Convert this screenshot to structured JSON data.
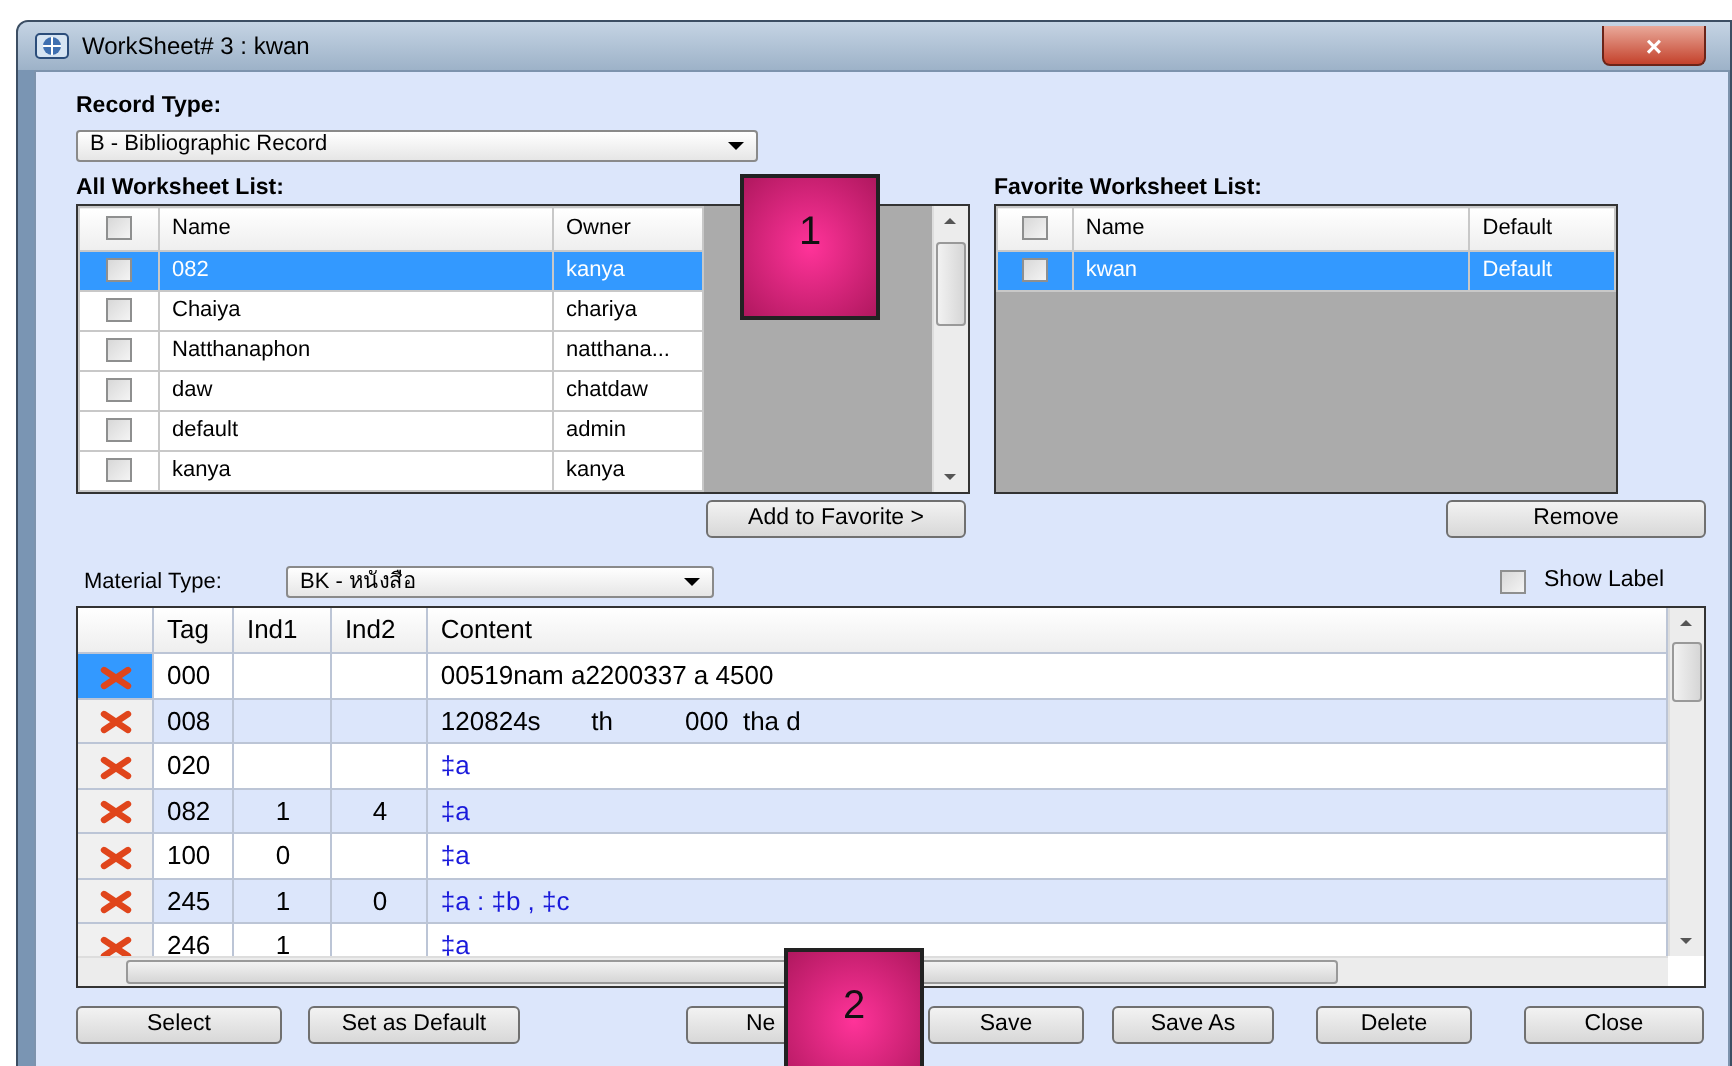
{
  "window": {
    "title": "WorkSheet# 3 : kwan",
    "close": "×"
  },
  "record_type": {
    "label": "Record Type:",
    "value": "B - Bibliographic Record"
  },
  "all_worksheets": {
    "label": "All Worksheet List:",
    "all_checked": false,
    "columns": [
      "Name",
      "Owner"
    ],
    "rows": [
      {
        "name": "082",
        "owner": "kanya",
        "checked": false,
        "selected": true
      },
      {
        "name": "Chaiya",
        "owner": "chariya",
        "checked": false,
        "selected": false
      },
      {
        "name": "Natthanaphon",
        "owner": "natthana...",
        "checked": false,
        "selected": false
      },
      {
        "name": "daw",
        "owner": "chatdaw",
        "checked": false,
        "selected": false
      },
      {
        "name": "default",
        "owner": "admin",
        "checked": false,
        "selected": false
      },
      {
        "name": "kanya",
        "owner": "kanya",
        "checked": false,
        "selected": false
      }
    ]
  },
  "add_to_favorite": "Add to Favorite >",
  "favorite_worksheets": {
    "label": "Favorite Worksheet List:",
    "all_checked": false,
    "columns": [
      "Name",
      "Default"
    ],
    "rows": [
      {
        "name": "kwan",
        "default": "Default",
        "checked": false,
        "selected": true
      }
    ]
  },
  "remove": "Remove",
  "material_type": {
    "label": "Material Type:",
    "value": "BK - หนังสือ"
  },
  "show_label": {
    "label": "Show Label",
    "checked": false
  },
  "marc_fields": {
    "columns": [
      "Tag",
      "Ind1",
      "Ind2",
      "Content"
    ],
    "rows": [
      {
        "tag": "000",
        "ind1": "",
        "ind2": "",
        "content": "00519nam a2200337 a 4500",
        "kind": "fixed",
        "selected": true
      },
      {
        "tag": "008",
        "ind1": "",
        "ind2": "",
        "content": "120824s       th          000  tha d",
        "kind": "fixed",
        "selected": false
      },
      {
        "tag": "020",
        "ind1": "",
        "ind2": "",
        "content": "‡a",
        "kind": "subfield",
        "selected": false
      },
      {
        "tag": "082",
        "ind1": "1",
        "ind2": "4",
        "content": "‡a",
        "kind": "subfield",
        "selected": false
      },
      {
        "tag": "100",
        "ind1": "0",
        "ind2": "",
        "content": "‡a",
        "kind": "subfield",
        "selected": false
      },
      {
        "tag": "245",
        "ind1": "1",
        "ind2": "0",
        "content": "‡a : ‡b , ‡c",
        "kind": "subfield",
        "selected": false
      },
      {
        "tag": "246",
        "ind1": "1",
        "ind2": "",
        "content": "‡a",
        "kind": "subfield",
        "selected": false
      }
    ]
  },
  "buttons": [
    "Select",
    "Set as Default",
    "Ne",
    "Save",
    "Save As",
    "Delete",
    "Close"
  ],
  "callouts": [
    "1",
    "2"
  ]
}
